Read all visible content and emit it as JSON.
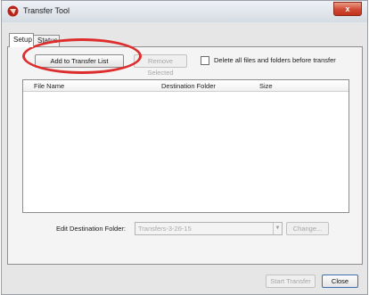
{
  "window": {
    "title": "Transfer Tool",
    "close_glyph": "x",
    "app_icon": "ti-logo-icon"
  },
  "tabs": [
    {
      "label": "Setup",
      "selected": true
    },
    {
      "label": "Status",
      "selected": false
    }
  ],
  "toolbar": {
    "add_label": "Add to Transfer List",
    "remove_label": "Remove Selected",
    "delete_checkbox_label": "Delete all files and folders before transfer",
    "delete_checked": false
  },
  "table": {
    "columns": [
      "File Name",
      "Destination Folder",
      "Size"
    ],
    "rows": []
  },
  "destination": {
    "label": "Edit Destination Folder:",
    "value": "Transfers-3-26-15",
    "change_label": "Change..."
  },
  "footer": {
    "start_label": "Start Transfer",
    "close_label": "Close"
  },
  "colors": {
    "callout": "#dd2d2d",
    "close_button_accent": "#3b6fb0"
  }
}
